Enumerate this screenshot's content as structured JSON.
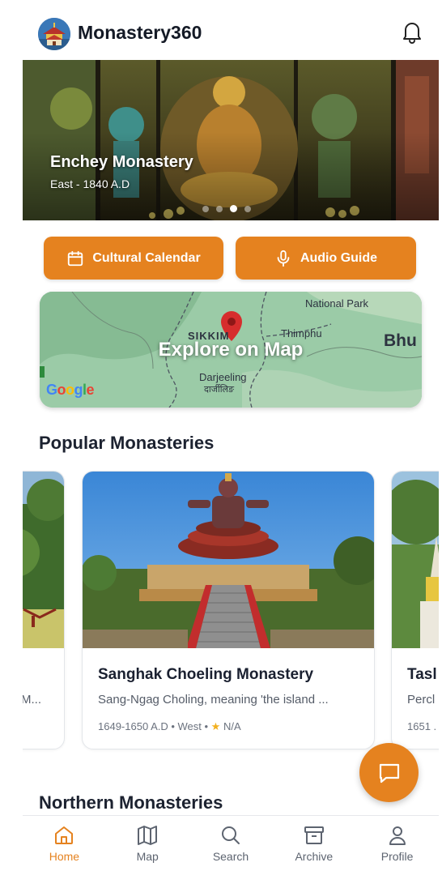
{
  "app": {
    "title": "Monastery360",
    "accent": "#e5821f"
  },
  "icons": {
    "logo": "monastery-logo",
    "bell": "bell-icon",
    "calendar": "calendar-icon",
    "mic": "microphone-icon",
    "chat": "chat-bubble-icon",
    "map_pin": "map-pin-icon"
  },
  "hero": {
    "title": "Enchey Monastery",
    "subtitle": "East - 1840 A.D",
    "slide_count": 4,
    "active_slide": 3
  },
  "actions": {
    "calendar_label": "Cultural Calendar",
    "audio_label": "Audio Guide"
  },
  "map": {
    "cta": "Explore on Map",
    "labels": {
      "national_park": "National Park",
      "sikkim": "SIKKIM",
      "thimphu": "Thimphu",
      "bhutan": "Bhu",
      "darjeeling": "Darjeeling",
      "darjeeling_hi": "दार्जीलिङ",
      "google": "Google"
    }
  },
  "popular": {
    "title": "Popular Monasteries",
    "cards": [
      {
        "name": "",
        "desc": "M...",
        "meta": ""
      },
      {
        "name": "Sanghak Choeling Monastery",
        "desc": "Sang-Ngag Choling, meaning 'the island ...",
        "meta_prefix": "1649-1650 A.D • West • ",
        "rating": "N/A"
      },
      {
        "name": "Tasl",
        "desc": "Percl",
        "meta": "1651 ."
      }
    ]
  },
  "northern": {
    "title": "Northern Monasteries"
  },
  "nav": {
    "items": [
      {
        "label": "Home",
        "icon": "home-icon",
        "active": true
      },
      {
        "label": "Map",
        "icon": "map-icon",
        "active": false
      },
      {
        "label": "Search",
        "icon": "search-icon",
        "active": false
      },
      {
        "label": "Archive",
        "icon": "archive-icon",
        "active": false
      },
      {
        "label": "Profile",
        "icon": "profile-icon",
        "active": false
      }
    ]
  }
}
